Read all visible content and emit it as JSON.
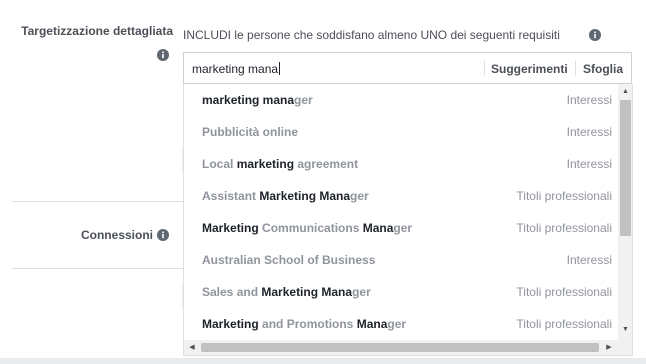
{
  "labels": {
    "detailed_targeting": "Targetizzazione dettagliata",
    "connections": "Connessioni"
  },
  "include_text": "INCLUDI le persone che soddisfano almeno UNO dei seguenti requisiti",
  "search": {
    "value": "marketing mana",
    "suggestions_label": "Suggerimenti",
    "browse_label": "Sfoglia"
  },
  "results": [
    {
      "parts": [
        {
          "t": "marketing mana",
          "m": true
        },
        {
          "t": "ger",
          "m": false
        }
      ],
      "category": "Interessi"
    },
    {
      "parts": [
        {
          "t": "Pubblicità online",
          "m": false
        }
      ],
      "category": "Interessi"
    },
    {
      "parts": [
        {
          "t": "Local ",
          "m": false
        },
        {
          "t": "marketing",
          "m": true
        },
        {
          "t": " agreement",
          "m": false
        }
      ],
      "category": "Interessi"
    },
    {
      "parts": [
        {
          "t": "Assistant ",
          "m": false
        },
        {
          "t": "Marketing Mana",
          "m": true
        },
        {
          "t": "ger",
          "m": false
        }
      ],
      "category": "Titoli professionali"
    },
    {
      "parts": [
        {
          "t": "Marketing",
          "m": true
        },
        {
          "t": " Communications ",
          "m": false
        },
        {
          "t": "Mana",
          "m": true
        },
        {
          "t": "ger",
          "m": false
        }
      ],
      "category": "Titoli professionali"
    },
    {
      "parts": [
        {
          "t": "Australian School of Business",
          "m": false
        }
      ],
      "category": "Interessi"
    },
    {
      "parts": [
        {
          "t": "Sales and ",
          "m": false
        },
        {
          "t": "Marketing Mana",
          "m": true
        },
        {
          "t": "ger",
          "m": false
        }
      ],
      "category": "Titoli professionali"
    },
    {
      "parts": [
        {
          "t": "Marketing",
          "m": true
        },
        {
          "t": " and Promotions ",
          "m": false
        },
        {
          "t": "Mana",
          "m": true
        },
        {
          "t": "ger",
          "m": false
        }
      ],
      "category": "Titoli professionali"
    }
  ],
  "icons": {
    "info": "info-icon",
    "scroll_up": "triangle-up-icon",
    "scroll_down": "triangle-down-icon",
    "scroll_left": "triangle-left-icon",
    "scroll_right": "triangle-right-icon"
  },
  "colors": {
    "match_text": "#1d2129",
    "unmatched_text": "#90949c",
    "border": "#ccd0d5",
    "label": "#4b4f56"
  }
}
